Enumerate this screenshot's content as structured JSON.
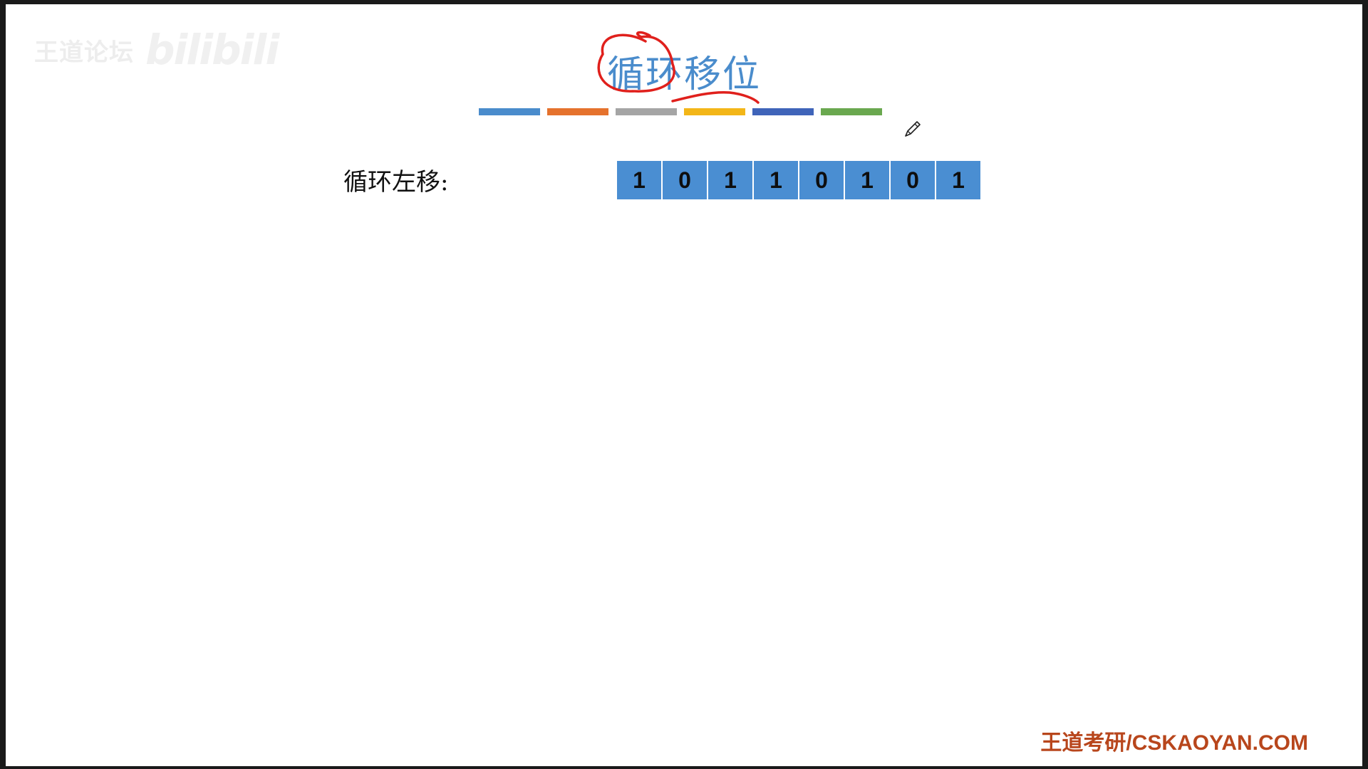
{
  "watermark": {
    "text": "王道论坛",
    "logo": "bilibili"
  },
  "slide": {
    "title": "循环移位",
    "row_label": "循环左移:",
    "bits": [
      "1",
      "0",
      "1",
      "1",
      "0",
      "1",
      "0",
      "1"
    ],
    "footer": "王道考研/CSKAOYAN.COM"
  },
  "colors": {
    "title": "#4a8ccc",
    "bit_cell": "#4a8ed2",
    "annotation": "#e0201c",
    "footer": "#b8461c",
    "bar_segments": [
      "#4a8ccc",
      "#e5722d",
      "#a5a5a5",
      "#f3b618",
      "#3f64b9",
      "#6aa84f"
    ]
  },
  "icons": {
    "cursor": "pencil-icon"
  }
}
